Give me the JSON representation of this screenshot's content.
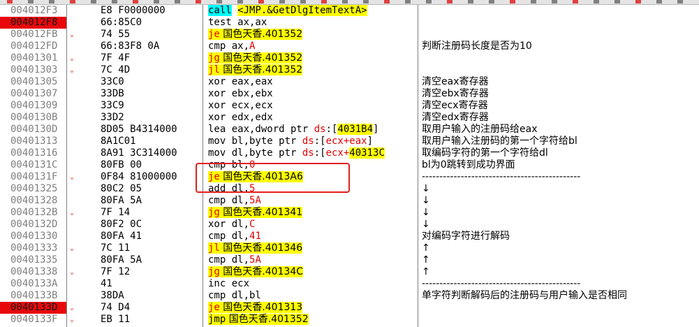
{
  "colors": {
    "breakpoint_bg": "#e8080a",
    "highlight_yellow": "#ffff00",
    "highlight_cyan": "#00ffff",
    "jump_red": "#e00000",
    "annotation_box": "#e21f1f"
  },
  "rows": [
    {
      "addr": "004012F3",
      "bp": false,
      "arrow": "",
      "bytes": "E8 F0000000",
      "dis": [
        {
          "t": "call",
          "c": "hl-c"
        },
        {
          "t": " "
        },
        {
          "t": "<JMP.&GetDlgItemTextA>",
          "c": "hl-y"
        }
      ],
      "comment": ""
    },
    {
      "addr": "004012F8",
      "bp": true,
      "arrow": "",
      "bytes": "66:85C0",
      "dis": [
        {
          "t": "test ax,ax"
        }
      ],
      "comment": ""
    },
    {
      "addr": "004012FB",
      "bp": false,
      "arrow": "⌄",
      "bytes": "74 55",
      "dis": [
        {
          "t": "je",
          "c": "hl-y kw-red"
        },
        {
          "t": " 国色天香.401352",
          "c": "hl-y"
        }
      ],
      "comment": ""
    },
    {
      "addr": "004012FD",
      "bp": false,
      "arrow": "",
      "bytes": "66:83F8 0A",
      "dis": [
        {
          "t": "cmp ax,"
        },
        {
          "t": "A",
          "c": "red"
        }
      ],
      "comment": "判断注册码长度是否为10"
    },
    {
      "addr": "00401301",
      "bp": false,
      "arrow": "⌄",
      "bytes": "7F 4F",
      "dis": [
        {
          "t": "jg",
          "c": "hl-y kw-red"
        },
        {
          "t": " 国色天香.401352",
          "c": "hl-y"
        }
      ],
      "comment": ""
    },
    {
      "addr": "00401303",
      "bp": false,
      "arrow": "⌄",
      "bytes": "7C 4D",
      "dis": [
        {
          "t": "jl",
          "c": "hl-y kw-red"
        },
        {
          "t": " 国色天香.401352",
          "c": "hl-y"
        }
      ],
      "comment": ""
    },
    {
      "addr": "00401305",
      "bp": false,
      "arrow": "",
      "bytes": "33C0",
      "dis": [
        {
          "t": "xor eax,eax"
        }
      ],
      "comment": "清空eax寄存器"
    },
    {
      "addr": "00401307",
      "bp": false,
      "arrow": "",
      "bytes": "33DB",
      "dis": [
        {
          "t": "xor ebx,ebx"
        }
      ],
      "comment": "清空ebx寄存器"
    },
    {
      "addr": "00401309",
      "bp": false,
      "arrow": "",
      "bytes": "33C9",
      "dis": [
        {
          "t": "xor ecx,ecx"
        }
      ],
      "comment": "清空ecx寄存器"
    },
    {
      "addr": "0040130B",
      "bp": false,
      "arrow": "",
      "bytes": "33D2",
      "dis": [
        {
          "t": "xor edx,edx"
        }
      ],
      "comment": "清空edx寄存器"
    },
    {
      "addr": "0040130D",
      "bp": false,
      "arrow": "",
      "bytes": "8D05 B4314000",
      "dis": [
        {
          "t": "lea eax,dword ptr "
        },
        {
          "t": "ds",
          "c": "red"
        },
        {
          "t": ":["
        },
        {
          "t": "4031B4",
          "c": "hl-y"
        },
        {
          "t": "]"
        }
      ],
      "comment": "取用户输入的注册码给eax"
    },
    {
      "addr": "00401313",
      "bp": false,
      "arrow": "",
      "bytes": "8A1C01",
      "dis": [
        {
          "t": "mov bl,byte ptr "
        },
        {
          "t": "ds",
          "c": "red"
        },
        {
          "t": ":["
        },
        {
          "t": "ecx+eax",
          "c": "red"
        },
        {
          "t": "]"
        }
      ],
      "comment": "取用户输入注册码的第一个字符给bl"
    },
    {
      "addr": "00401316",
      "bp": false,
      "arrow": "",
      "bytes": "8A91 3C314000",
      "dis": [
        {
          "t": "mov dl,byte ptr "
        },
        {
          "t": "ds",
          "c": "red"
        },
        {
          "t": ":["
        },
        {
          "t": "ecx+",
          "c": "red"
        },
        {
          "t": "40313C",
          "c": "hl-y"
        }
      ],
      "comment": "取编码字符的第一个字符给dl"
    },
    {
      "addr": "0040131C",
      "bp": false,
      "arrow": "",
      "bytes": "80FB 00",
      "dis": [
        {
          "t": "cmp bl,"
        },
        {
          "t": "0",
          "c": "red"
        }
      ],
      "comment": "bl为0跳转到成功界面"
    },
    {
      "addr": "0040131F",
      "bp": false,
      "arrow": "⌄",
      "bytes": "0F84 81000000",
      "dis": [
        {
          "t": "je",
          "c": "hl-y kw-red"
        },
        {
          "t": " 国色天香.4013A6",
          "c": "hl-y"
        }
      ],
      "comment": "---------------------------------------------"
    },
    {
      "addr": "00401325",
      "bp": false,
      "arrow": "",
      "bytes": "80C2 05",
      "dis": [
        {
          "t": "add dl,"
        },
        {
          "t": "5",
          "c": "red"
        }
      ],
      "comment": "↓"
    },
    {
      "addr": "00401328",
      "bp": false,
      "arrow": "",
      "bytes": "80FA 5A",
      "dis": [
        {
          "t": "cmp dl,"
        },
        {
          "t": "5A",
          "c": "red"
        }
      ],
      "comment": "↓"
    },
    {
      "addr": "0040132B",
      "bp": false,
      "arrow": "⌄",
      "bytes": "7F 14",
      "dis": [
        {
          "t": "jg",
          "c": "hl-y kw-red"
        },
        {
          "t": " 国色天香.401341",
          "c": "hl-y"
        }
      ],
      "comment": "↓"
    },
    {
      "addr": "0040132D",
      "bp": false,
      "arrow": "",
      "bytes": "80F2 0C",
      "dis": [
        {
          "t": "xor dl,"
        },
        {
          "t": "C",
          "c": "red"
        }
      ],
      "comment": "↓"
    },
    {
      "addr": "00401330",
      "bp": false,
      "arrow": "",
      "bytes": "80FA 41",
      "dis": [
        {
          "t": "cmp dl,"
        },
        {
          "t": "41",
          "c": "red"
        }
      ],
      "comment": "对编码字符进行解码"
    },
    {
      "addr": "00401333",
      "bp": false,
      "arrow": "⌄",
      "bytes": "7C 11",
      "dis": [
        {
          "t": "jl",
          "c": "hl-y kw-red"
        },
        {
          "t": " 国色天香.401346",
          "c": "hl-y"
        }
      ],
      "comment": "↑"
    },
    {
      "addr": "00401335",
      "bp": false,
      "arrow": "",
      "bytes": "80FA 5A",
      "dis": [
        {
          "t": "cmp dl,"
        },
        {
          "t": "5A",
          "c": "red"
        }
      ],
      "comment": "↑"
    },
    {
      "addr": "00401338",
      "bp": false,
      "arrow": "⌄",
      "bytes": "7F 12",
      "dis": [
        {
          "t": "jg",
          "c": "hl-y kw-red"
        },
        {
          "t": " 国色天香.40134C",
          "c": "hl-y"
        }
      ],
      "comment": "↑"
    },
    {
      "addr": "0040133A",
      "bp": false,
      "arrow": "",
      "bytes": "41",
      "dis": [
        {
          "t": "inc ecx"
        }
      ],
      "comment": "---------------------------------------------"
    },
    {
      "addr": "0040133B",
      "bp": false,
      "arrow": "",
      "bytes": "38DA",
      "dis": [
        {
          "t": "cmp dl,bl"
        }
      ],
      "comment": "单字符判断解码后的注册码与用户输入是否相同"
    },
    {
      "addr": "0040133D",
      "bp": true,
      "arrow": "⌄",
      "bytes": "74 D4",
      "dis": [
        {
          "t": "je",
          "c": "hl-y kw-red"
        },
        {
          "t": " 国色天香.401313",
          "c": "hl-y"
        }
      ],
      "comment": ""
    },
    {
      "addr": "0040133F",
      "bp": false,
      "arrow": "⌄",
      "bytes": "EB 11",
      "dis": [
        {
          "t": "jmp",
          "c": "hl-y"
        },
        {
          "t": " 国色天香.401352",
          "c": "hl-y"
        }
      ],
      "comment": ""
    }
  ]
}
